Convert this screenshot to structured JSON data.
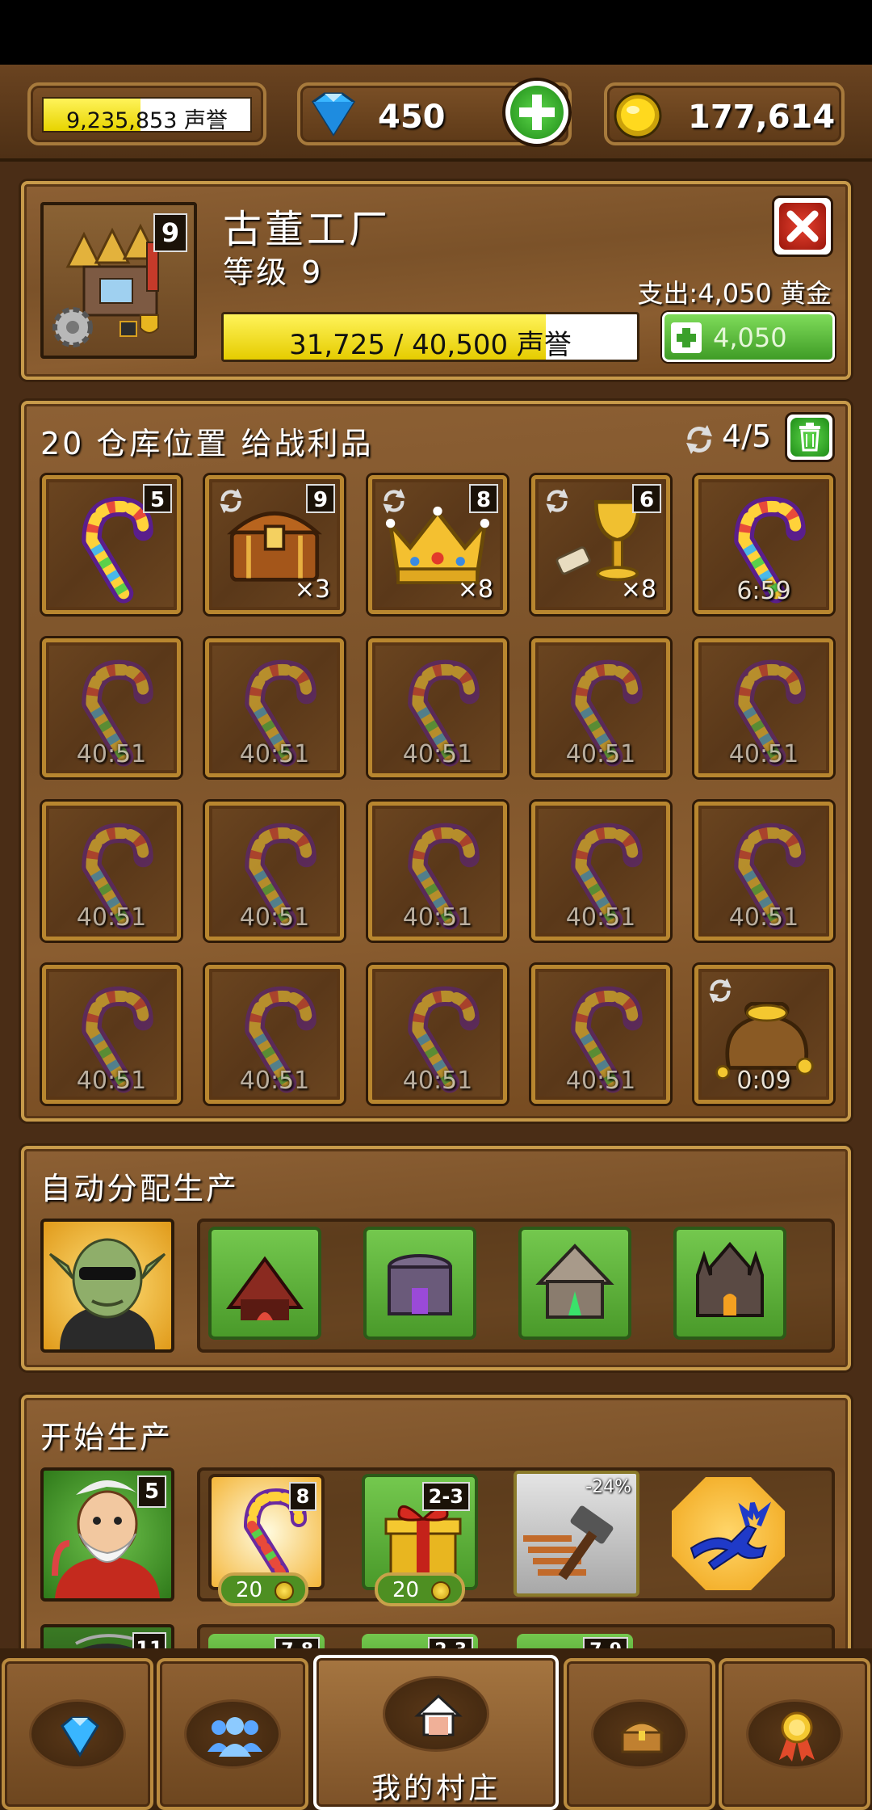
{
  "status_bar": {
    "bg": "#000000"
  },
  "top": {
    "reputation_value": "9,235,853 声誉",
    "reputation_fill": 0.47,
    "gems": "450",
    "gold": "177,614"
  },
  "building": {
    "name": "古董工厂",
    "level_text": "等级 9",
    "level_badge": "9",
    "cost_text": "支出:4,050 黄金",
    "progress_text": "31,725 / 40,500 声誉",
    "progress_fraction": 0.78,
    "upgrade_label": "4,050"
  },
  "storage": {
    "title": "20 仓库位置 给战利品",
    "refresh_count": "4/5",
    "slots": [
      {
        "item": "candy-cane",
        "level": "5",
        "count": "",
        "time": "",
        "refresh": false,
        "dim": false
      },
      {
        "item": "treasure-chest",
        "level": "9",
        "count": "×3",
        "time": "",
        "refresh": true,
        "dim": false
      },
      {
        "item": "crown",
        "level": "8",
        "count": "×8",
        "time": "",
        "refresh": true,
        "dim": false
      },
      {
        "item": "goblet",
        "level": "6",
        "count": "×8",
        "time": "",
        "refresh": true,
        "dim": false
      },
      {
        "item": "candy-cane",
        "level": "",
        "count": "",
        "time": "6:59",
        "refresh": false,
        "dim": false
      },
      {
        "item": "candy-cane",
        "level": "",
        "count": "",
        "time": "40:51",
        "refresh": false,
        "dim": true
      },
      {
        "item": "candy-cane",
        "level": "",
        "count": "",
        "time": "40:51",
        "refresh": false,
        "dim": true
      },
      {
        "item": "candy-cane",
        "level": "",
        "count": "",
        "time": "40:51",
        "refresh": false,
        "dim": true
      },
      {
        "item": "candy-cane",
        "level": "",
        "count": "",
        "time": "40:51",
        "refresh": false,
        "dim": true
      },
      {
        "item": "candy-cane",
        "level": "",
        "count": "",
        "time": "40:51",
        "refresh": false,
        "dim": true
      },
      {
        "item": "candy-cane",
        "level": "",
        "count": "",
        "time": "40:51",
        "refresh": false,
        "dim": true
      },
      {
        "item": "candy-cane",
        "level": "",
        "count": "",
        "time": "40:51",
        "refresh": false,
        "dim": true
      },
      {
        "item": "candy-cane",
        "level": "",
        "count": "",
        "time": "40:51",
        "refresh": false,
        "dim": true
      },
      {
        "item": "candy-cane",
        "level": "",
        "count": "",
        "time": "40:51",
        "refresh": false,
        "dim": true
      },
      {
        "item": "candy-cane",
        "level": "",
        "count": "",
        "time": "40:51",
        "refresh": false,
        "dim": true
      },
      {
        "item": "candy-cane",
        "level": "",
        "count": "",
        "time": "40:51",
        "refresh": false,
        "dim": true
      },
      {
        "item": "candy-cane",
        "level": "",
        "count": "",
        "time": "40:51",
        "refresh": false,
        "dim": true
      },
      {
        "item": "candy-cane",
        "level": "",
        "count": "",
        "time": "40:51",
        "refresh": false,
        "dim": true
      },
      {
        "item": "candy-cane",
        "level": "",
        "count": "",
        "time": "40:51",
        "refresh": false,
        "dim": true
      },
      {
        "item": "gold-sack",
        "level": "",
        "count": "",
        "time": "0:09",
        "refresh": true,
        "dim": false
      }
    ]
  },
  "auto": {
    "title": "自动分配生产",
    "buildings": [
      "red-tent-building",
      "purple-tower-building",
      "crystal-temple-building",
      "dark-castle-building"
    ]
  },
  "production": {
    "title": "开始生产",
    "worker_level": "5",
    "items": [
      {
        "name": "candy-cane",
        "badge": "8",
        "price": "20"
      },
      {
        "name": "gift-box",
        "badge": "2-3",
        "price": "20"
      },
      {
        "name": "hammer-boost",
        "badge": "-24%",
        "price": ""
      },
      {
        "name": "reindeer-boost",
        "badge": "",
        "price": ""
      }
    ],
    "next_worker_level": "11",
    "next_badges": [
      "7-8",
      "2-3",
      "7-9"
    ]
  },
  "nav": {
    "village_label": "我的村庄",
    "items": [
      "gems-icon",
      "friends-icon",
      "home-icon",
      "chest-icon",
      "medal-icon"
    ]
  }
}
